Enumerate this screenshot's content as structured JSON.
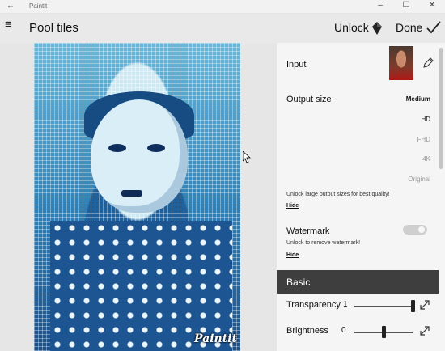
{
  "window": {
    "title": "Paintit",
    "minimize": "–",
    "maximize": "☐",
    "close": "✕",
    "back": "←"
  },
  "header": {
    "menu_glyph": "≡",
    "filter_name": "Pool tiles",
    "unlock_label": "Unlock",
    "done_label": "Done"
  },
  "canvas": {
    "watermark_text": "Paintit"
  },
  "panel": {
    "input_label": "Input",
    "output_size_label": "Output size",
    "output_sizes": [
      "Medium",
      "HD",
      "FHD",
      "4K",
      "Original"
    ],
    "selected_size": "Medium",
    "unlock_note": "Unlock large output sizes for best quality!",
    "hide1": "Hide",
    "watermark_label": "Watermark",
    "watermark_note": "Unlock to remove watermark!",
    "hide2": "Hide",
    "watermark_enabled": true,
    "section_basic": "Basic",
    "transparency_label": "Transparency",
    "transparency_value": "1",
    "transparency_level": 1,
    "brightness_label": "Brightness",
    "brightness_value": "0",
    "brightness_level": 0.5
  },
  "icons": [
    "back-arrow-icon",
    "hamburger-menu-icon",
    "diamond-icon",
    "checkmark-icon",
    "pencil-icon",
    "expand-icon",
    "cursor-icon"
  ]
}
